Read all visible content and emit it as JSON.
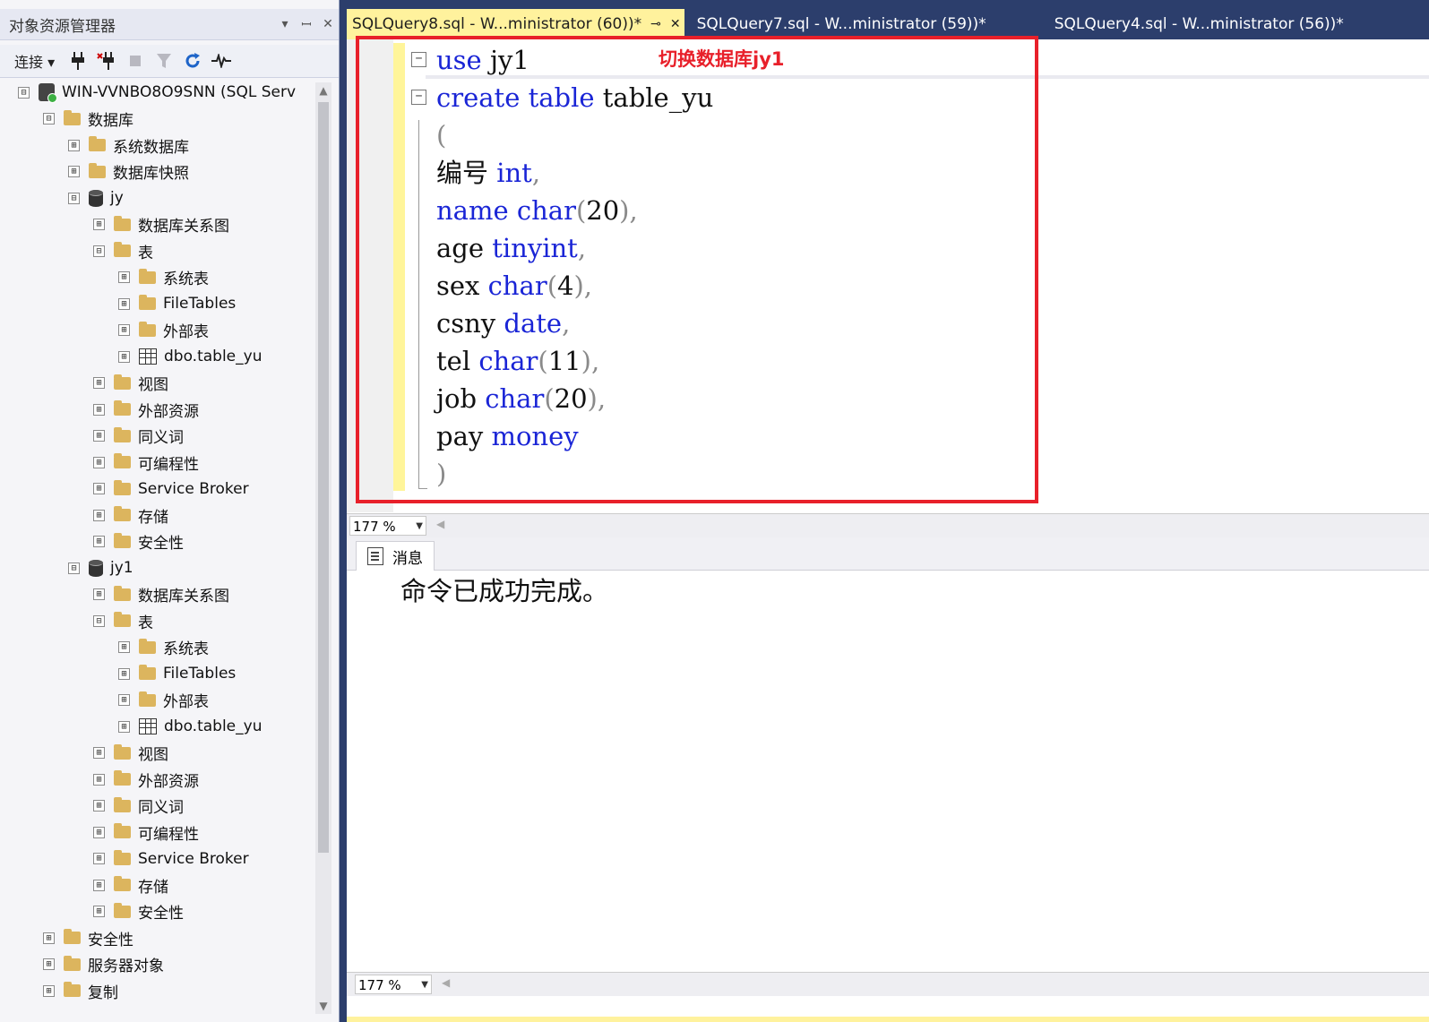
{
  "object_explorer": {
    "title": "对象资源管理器",
    "title_controls": {
      "dropdown": "▾",
      "pin": "ꟷ",
      "close": "✕"
    },
    "toolbar": {
      "connect_label": "连接 ▾"
    },
    "tree": [
      {
        "label": "WIN-VVNBO8O9SNN (SQL Serv",
        "icon": "server",
        "exp": "⊟"
      },
      {
        "label": "数据库",
        "icon": "folder",
        "exp": "⊟"
      },
      {
        "label": "系统数据库",
        "icon": "folder",
        "exp": "⊞"
      },
      {
        "label": "数据库快照",
        "icon": "folder",
        "exp": "⊞"
      },
      {
        "label": "jy",
        "icon": "database",
        "exp": "⊟"
      },
      {
        "label": "数据库关系图",
        "icon": "folder",
        "exp": "⊞"
      },
      {
        "label": "表",
        "icon": "folder",
        "exp": "⊟"
      },
      {
        "label": "系统表",
        "icon": "folder",
        "exp": "⊞"
      },
      {
        "label": "FileTables",
        "icon": "folder",
        "exp": "⊞"
      },
      {
        "label": "外部表",
        "icon": "folder",
        "exp": "⊞"
      },
      {
        "label": "dbo.table_yu",
        "icon": "table",
        "exp": "⊞"
      },
      {
        "label": "视图",
        "icon": "folder",
        "exp": "⊞"
      },
      {
        "label": "外部资源",
        "icon": "folder",
        "exp": "⊞"
      },
      {
        "label": "同义词",
        "icon": "folder",
        "exp": "⊞"
      },
      {
        "label": "可编程性",
        "icon": "folder",
        "exp": "⊞"
      },
      {
        "label": "Service Broker",
        "icon": "folder",
        "exp": "⊞"
      },
      {
        "label": "存储",
        "icon": "folder",
        "exp": "⊞"
      },
      {
        "label": "安全性",
        "icon": "folder",
        "exp": "⊞"
      },
      {
        "label": "jy1",
        "icon": "database",
        "exp": "⊟"
      },
      {
        "label": "数据库关系图",
        "icon": "folder",
        "exp": "⊞"
      },
      {
        "label": "表",
        "icon": "folder",
        "exp": "⊟"
      },
      {
        "label": "系统表",
        "icon": "folder",
        "exp": "⊞"
      },
      {
        "label": "FileTables",
        "icon": "folder",
        "exp": "⊞"
      },
      {
        "label": "外部表",
        "icon": "folder",
        "exp": "⊞"
      },
      {
        "label": "dbo.table_yu",
        "icon": "table",
        "exp": "⊞"
      },
      {
        "label": "视图",
        "icon": "folder",
        "exp": "⊞"
      },
      {
        "label": "外部资源",
        "icon": "folder",
        "exp": "⊞"
      },
      {
        "label": "同义词",
        "icon": "folder",
        "exp": "⊞"
      },
      {
        "label": "可编程性",
        "icon": "folder",
        "exp": "⊞"
      },
      {
        "label": "Service Broker",
        "icon": "folder",
        "exp": "⊞"
      },
      {
        "label": "存储",
        "icon": "folder",
        "exp": "⊞"
      },
      {
        "label": "安全性",
        "icon": "folder",
        "exp": "⊞"
      },
      {
        "label": "安全性",
        "icon": "folder",
        "exp": "⊞"
      },
      {
        "label": "服务器对象",
        "icon": "folder",
        "exp": "⊞"
      },
      {
        "label": "复制",
        "icon": "folder",
        "exp": "⊞"
      }
    ]
  },
  "tabs": [
    {
      "label": "SQLQuery8.sql - W...ministrator (60))*",
      "active": true,
      "pin": "⊸",
      "close": "✕"
    },
    {
      "label": "SQLQuery7.sql - W...ministrator (59))*",
      "active": false
    },
    {
      "label": "SQLQuery4.sql - W...ministrator (56))*",
      "active": false
    }
  ],
  "editor": {
    "annotation": "切换数据库jy1",
    "fold_minus": "−",
    "lines": [
      [
        {
          "t": "use",
          "k": "kw"
        },
        {
          "t": " jy1",
          "k": ""
        }
      ],
      [
        {
          "t": "create",
          "k": "kw"
        },
        {
          "t": " ",
          "k": ""
        },
        {
          "t": "table",
          "k": "kw"
        },
        {
          "t": " table_yu",
          "k": ""
        }
      ],
      [
        {
          "t": "(",
          "k": "pn"
        }
      ],
      [
        {
          "t": "编号 ",
          "k": ""
        },
        {
          "t": "int",
          "k": "kw"
        },
        {
          "t": ",",
          "k": "pn"
        }
      ],
      [
        {
          "t": "name",
          "k": "kw"
        },
        {
          "t": " ",
          "k": ""
        },
        {
          "t": "char",
          "k": "kw"
        },
        {
          "t": "(",
          "k": "pn"
        },
        {
          "t": "20",
          "k": ""
        },
        {
          "t": "),",
          "k": "pn"
        }
      ],
      [
        {
          "t": "age ",
          "k": ""
        },
        {
          "t": "tinyint",
          "k": "kw"
        },
        {
          "t": ",",
          "k": "pn"
        }
      ],
      [
        {
          "t": "sex ",
          "k": ""
        },
        {
          "t": "char",
          "k": "kw"
        },
        {
          "t": "(",
          "k": "pn"
        },
        {
          "t": "4",
          "k": ""
        },
        {
          "t": "),",
          "k": "pn"
        }
      ],
      [
        {
          "t": "csny ",
          "k": ""
        },
        {
          "t": "date",
          "k": "kw"
        },
        {
          "t": ",",
          "k": "pn"
        }
      ],
      [
        {
          "t": "tel ",
          "k": ""
        },
        {
          "t": "char",
          "k": "kw"
        },
        {
          "t": "(",
          "k": "pn"
        },
        {
          "t": "11",
          "k": ""
        },
        {
          "t": "),",
          "k": "pn"
        }
      ],
      [
        {
          "t": "job ",
          "k": ""
        },
        {
          "t": "char",
          "k": "kw"
        },
        {
          "t": "(",
          "k": "pn"
        },
        {
          "t": "20",
          "k": ""
        },
        {
          "t": "),",
          "k": "pn"
        }
      ],
      [
        {
          "t": "pay ",
          "k": ""
        },
        {
          "t": "money",
          "k": "kw"
        }
      ],
      [
        {
          "t": ")",
          "k": "pn"
        }
      ]
    ]
  },
  "zoom_editor": "177 %",
  "zoom_results": "177 %",
  "results": {
    "tab_label": "消息",
    "message": "命令已成功完成。"
  },
  "colors": {
    "keyword": "#1a25d6",
    "annotation_red": "#e8202a",
    "active_tab": "#fff29d",
    "chrome_dark": "#2c3e6c"
  }
}
